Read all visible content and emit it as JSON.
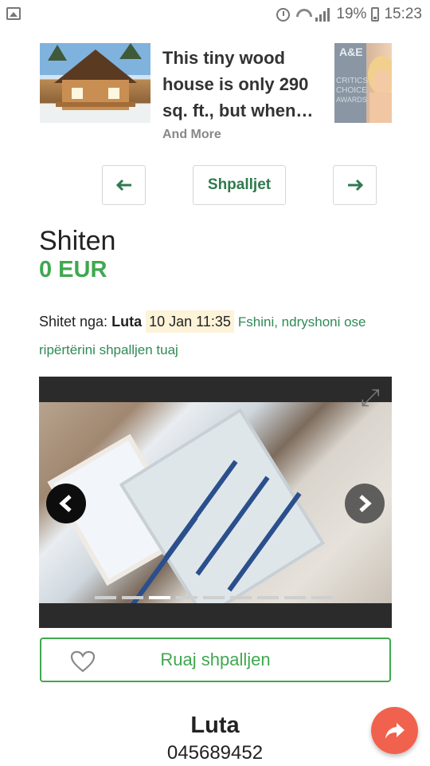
{
  "status_bar": {
    "battery": "19%",
    "time": "15:23",
    "icons": [
      "image-icon",
      "alarm-icon",
      "wifi-icon",
      "signal-icon",
      "battery-icon"
    ]
  },
  "promo": {
    "title": "This tiny wood house is only 290 sq. ft., but when…",
    "more": "And More",
    "thumb_right_text": "A&E CRITICS CHOICE AWARDS"
  },
  "nav": {
    "prev_icon": "arrow-left-icon",
    "list_label": "Shpalljet",
    "next_icon": "arrow-right-icon"
  },
  "listing": {
    "title": "Shiten",
    "price": "0 EUR",
    "sold_by_label": "Shitet nga:",
    "seller": "Luta",
    "date": "10 Jan 11:35",
    "edit_link": "Fshini, ndryshoni ose ripërtërini shpalljen tuaj"
  },
  "gallery": {
    "slide_count": 9,
    "active_slide": 3,
    "expand_icon": "expand-icon"
  },
  "save": {
    "label": "Ruaj shpalljen"
  },
  "contact": {
    "name": "Luta",
    "phone": "045689452"
  },
  "colors": {
    "green": "#3fa84f",
    "dark_green": "#2e7a4e",
    "fab": "#f0624d",
    "date_highlight": "#fdf3d8"
  }
}
